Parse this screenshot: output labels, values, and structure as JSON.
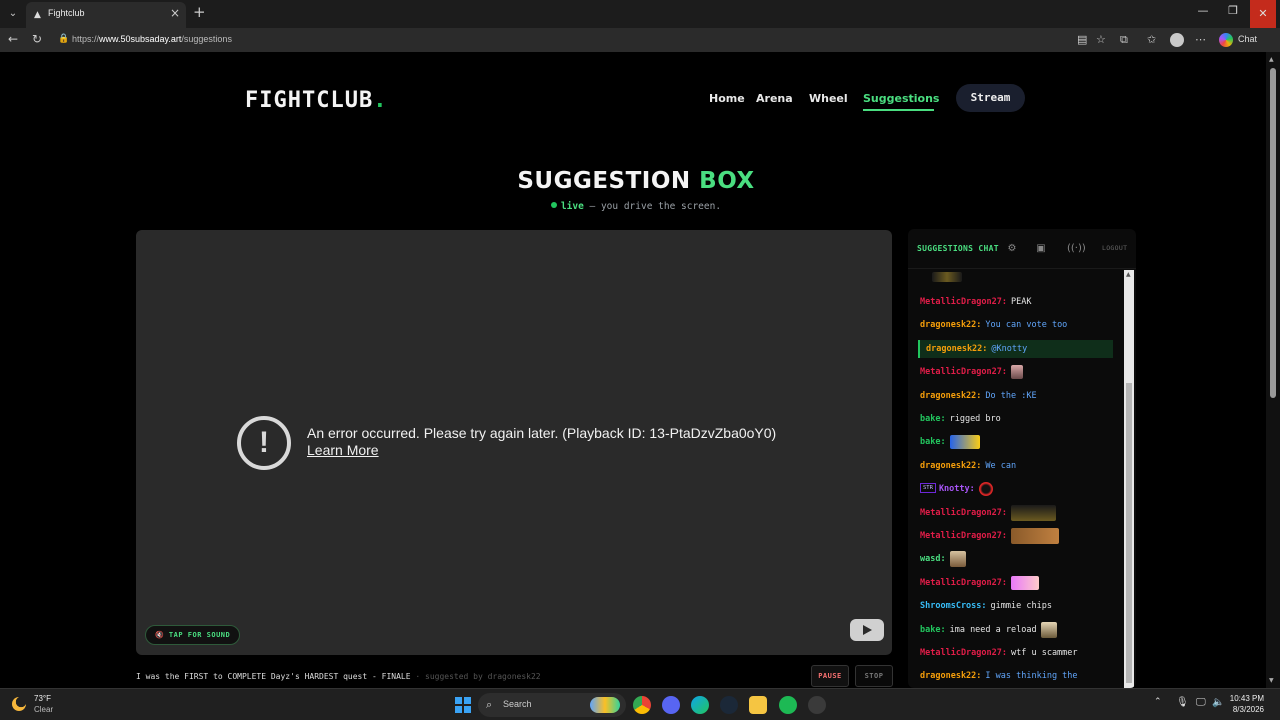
{
  "browser": {
    "tab_title": "Fightclub",
    "url_prefix": "https://",
    "url_host": "www.50subsaday.art",
    "url_path": "/suggestions",
    "chat_label": "Chat"
  },
  "site": {
    "logo_text": "FIGHTCLUB",
    "logo_dot": ".",
    "nav": [
      "Home",
      "Arena",
      "Wheel",
      "Suggestions"
    ],
    "active_nav": "Suggestions",
    "stream_button": "Stream",
    "title_main": "SUGGESTION",
    "title_accent": "BOX",
    "live_word": "live",
    "subtitle_rest": " — you drive the screen."
  },
  "player": {
    "error_message": "An error occurred. Please try again later. (Playback ID: 13-PtaDzvZba0oY0)",
    "learn_more": "Learn More",
    "tap_for_sound": "🔇 TAP FOR SOUND",
    "now_playing": "I was the FIRST to COMPLETE Dayz's HARDEST quest - FINALE",
    "suggested_by": " · suggested by dragonesk22",
    "pause": "PAUSE",
    "stop": "STOP"
  },
  "chat": {
    "title": "SUGGESTIONS CHAT",
    "logout": "LOGOUT",
    "messages": [
      {
        "user": "MetallicDragon27:",
        "text": "PEAK"
      },
      {
        "user": "dragonesk22:",
        "text": "You can vote too"
      },
      {
        "user": "dragonesk22:",
        "text": "@Knotty"
      },
      {
        "user": "MetallicDragon27:",
        "text": ""
      },
      {
        "user": "dragonesk22:",
        "text": "Do the :KE"
      },
      {
        "user": "bake:",
        "text": "rigged bro"
      },
      {
        "user": "bake:",
        "text": ""
      },
      {
        "user": "dragonesk22:",
        "text": "We can"
      },
      {
        "user": "Knotty:",
        "text": "",
        "badge": "STR"
      },
      {
        "user": "MetallicDragon27:",
        "text": ""
      },
      {
        "user": "MetallicDragon27:",
        "text": ""
      },
      {
        "user": "wasd:",
        "text": ""
      },
      {
        "user": "MetallicDragon27:",
        "text": ""
      },
      {
        "user": "ShroomsCross:",
        "text": "gimmie chips"
      },
      {
        "user": "bake:",
        "text": "ima need a reload"
      },
      {
        "user": "MetallicDragon27:",
        "text": "wtf u scammer"
      },
      {
        "user": "dragonesk22:",
        "text": "I was thinking the"
      }
    ],
    "colors": {
      "MetallicDragon27": "#e11d48",
      "dragonesk22": "#f59e0b",
      "bake": "#22c55e",
      "Knotty": "#a855f7",
      "wasd": "#4ade80",
      "ShroomsCross": "#38bdf8"
    }
  },
  "taskbar": {
    "temp": "73°F",
    "condition": "Clear",
    "search": "Search",
    "time": "10:43 PM",
    "date": "8/3/2026"
  }
}
